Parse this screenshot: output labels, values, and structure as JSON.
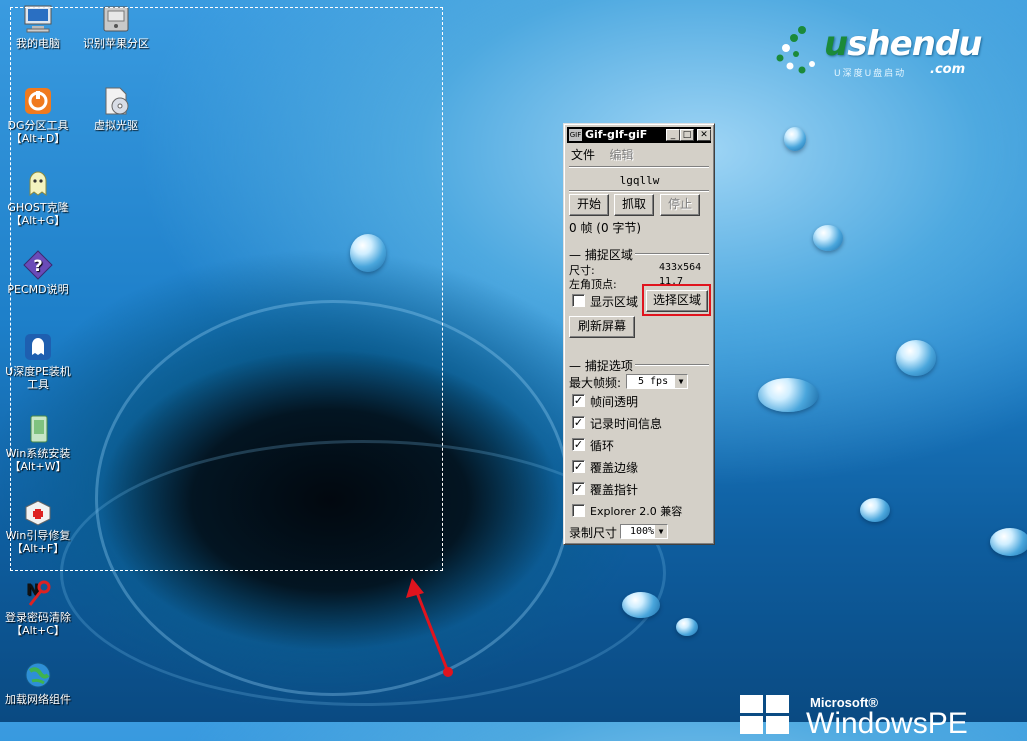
{
  "desktop": {
    "icons": [
      {
        "label": "我的电脑",
        "label2": "",
        "icon": "computer-icon"
      },
      {
        "label": "识别苹果分区",
        "label2": "",
        "icon": "drive-icon"
      },
      {
        "label": "DG分区工具",
        "label2": "【Alt+D】",
        "icon": "diskgenius-icon"
      },
      {
        "label": "虚拟光驱",
        "label2": "",
        "icon": "virtual-cd-icon"
      },
      {
        "label": "GHOST克隆",
        "label2": "【Alt+G】",
        "icon": "ghost-icon"
      },
      {
        "label": "PECMD说明",
        "label2": "",
        "icon": "help-icon"
      },
      {
        "label": "U深度PE装机",
        "label2": "工具",
        "icon": "installer-icon"
      },
      {
        "label": "Win系统安装",
        "label2": "【Alt+W】",
        "icon": "setup-icon"
      },
      {
        "label": "Win引导修复",
        "label2": "【Alt+F】",
        "icon": "repair-icon"
      },
      {
        "label": "登录密码清除",
        "label2": "【Alt+C】",
        "icon": "password-clear-icon"
      },
      {
        "label": "加载网络组件",
        "label2": "",
        "icon": "network-icon"
      }
    ],
    "logo": {
      "text_u": "u",
      "text_rest": "shendu",
      "sub": "U深度U盘启动",
      "com": ".com"
    },
    "brand": {
      "microsoft": "Microsoft®",
      "product": "WindowsPE"
    }
  },
  "window": {
    "title": "Gif-gIf-giF",
    "menu": {
      "file": "文件",
      "edit": "编辑"
    },
    "filename": "lgqllw",
    "buttons": {
      "start": "开始",
      "grab": "抓取",
      "stop": "停止"
    },
    "status": "0 帧 (0 字节)",
    "capture_area": {
      "group_label": "捕捉区域",
      "size_label": "尺寸:",
      "size_value": "433x564",
      "origin_label": "左角顶点:",
      "origin_value": "11,7",
      "show_area_label": "显示区域",
      "show_area_checked": false,
      "select_area_button": "选择区域",
      "refresh_button": "刷新屏幕"
    },
    "capture_options": {
      "group_label": "捕捉选项",
      "max_fps_label": "最大帧频:",
      "max_fps_value": "5 fps",
      "options": [
        {
          "label": "帧间透明",
          "checked": true
        },
        {
          "label": "记录时间信息",
          "checked": true
        },
        {
          "label": "循环",
          "checked": true
        },
        {
          "label": "覆盖边缘",
          "checked": true
        },
        {
          "label": "覆盖指针",
          "checked": true
        },
        {
          "label": "Explorer 2.0 兼容",
          "checked": false
        }
      ],
      "record_size_label": "录制尺寸",
      "record_size_value": "100%"
    }
  },
  "colors": {
    "highlight": "#e0141e",
    "arrow": "#e0141e",
    "selection": "#ffffff"
  }
}
